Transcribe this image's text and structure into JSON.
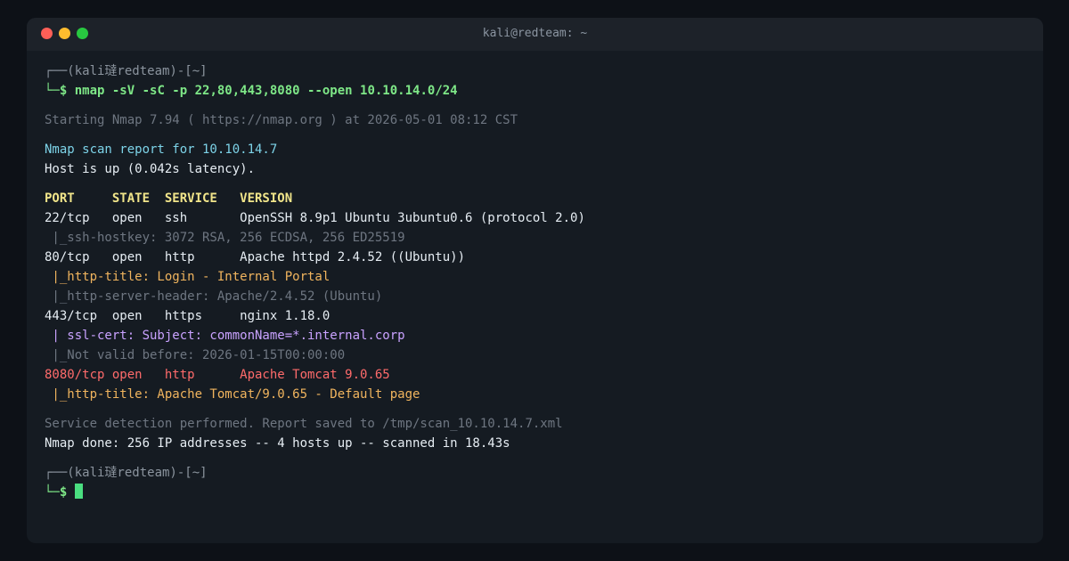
{
  "window": {
    "title": "kali@redteam: ~",
    "colors": {
      "background": "#151b22",
      "titlebar": "#1d2229",
      "close": "#ff5f57",
      "minimize": "#febc2e",
      "maximize": "#28c840"
    }
  },
  "terminal": {
    "prompt_header_1": "┌──(kali㼀redteam)-[~]",
    "prompt_symbol_1": "└─$",
    "command": "nmap -sV -sC -p 22,80,443,8080 --open 10.10.14.0/24",
    "starting": "Starting Nmap 7.94 ( https://nmap.org ) at 2026-05-01 08:12 CST",
    "scan_report": "Nmap scan report for 10.10.14.7",
    "host_up": "Host is up (0.042s latency).",
    "table_header": "PORT     STATE  SERVICE   VERSION",
    "rows": [
      "22/tcp   open   ssh       OpenSSH 8.9p1 Ubuntu 3ubuntu0.6 (protocol 2.0)",
      " |_ssh-hostkey: 3072 RSA, 256 ECDSA, 256 ED25519",
      "80/tcp   open   http      Apache httpd 2.4.52 ((Ubuntu))",
      " |_http-title: Login - Internal Portal",
      " |_http-server-header: Apache/2.4.52 (Ubuntu)",
      "443/tcp  open   https     nginx 1.18.0",
      " | ssl-cert: Subject: commonName=*.internal.corp",
      " |_Not valid before: 2026-01-15T00:00:00",
      "8080/tcp open   http      Apache Tomcat 9.0.65",
      " |_http-title: Apache Tomcat/9.0.65 - Default page"
    ],
    "service_detection": "Service detection performed. Report saved to /tmp/scan_10.10.14.7.xml",
    "nmap_done": "Nmap done: 256 IP addresses -- 4 hosts up -- scanned in 18.43s",
    "prompt_header_2": "┌──(kali㼀redteam)-[~]",
    "prompt_symbol_2": "└─$"
  }
}
